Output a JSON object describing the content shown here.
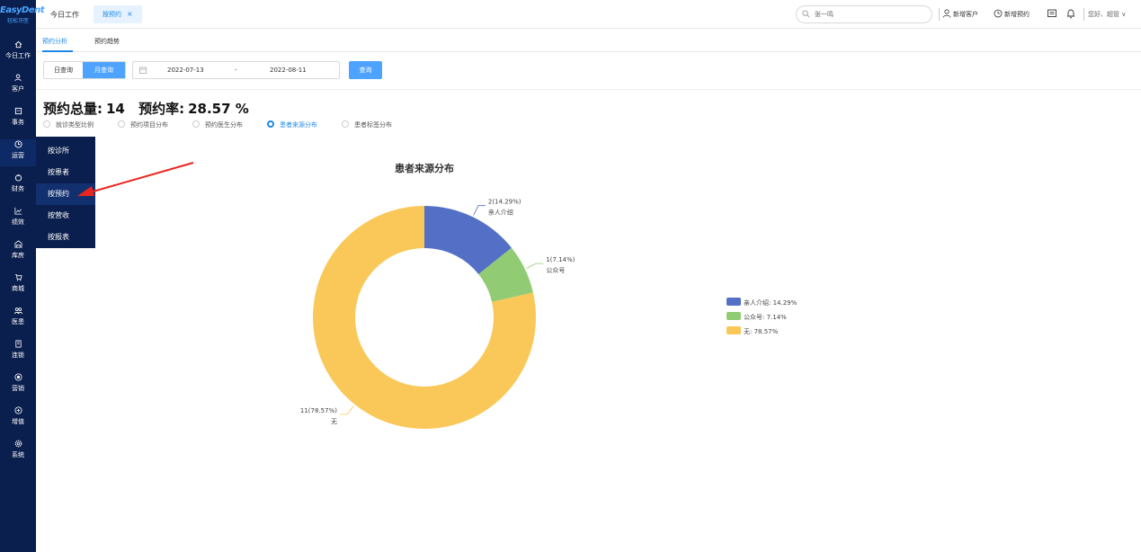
{
  "brand": {
    "name": "EasyDent",
    "subtitle": "轻松牙医"
  },
  "sidebar": {
    "items": [
      {
        "icon": "home-icon",
        "label": "今日工作"
      },
      {
        "icon": "user-icon",
        "label": "客户"
      },
      {
        "icon": "calendar-icon",
        "label": "事务"
      },
      {
        "icon": "clock-icon",
        "label": "运营"
      },
      {
        "icon": "wallet-icon",
        "label": "财务"
      },
      {
        "icon": "line-chart-icon",
        "label": "绩效"
      },
      {
        "icon": "warehouse-icon",
        "label": "库房"
      },
      {
        "icon": "cart-icon",
        "label": "商城"
      },
      {
        "icon": "doctor-icon",
        "label": "医患"
      },
      {
        "icon": "building-icon",
        "label": "连锁"
      },
      {
        "icon": "target-icon",
        "label": "营销"
      },
      {
        "icon": "value-added-icon",
        "label": "增值"
      },
      {
        "icon": "settings-icon",
        "label": "系统"
      }
    ],
    "active_index": 3
  },
  "flyout": {
    "items": [
      "按诊所",
      "按患者",
      "按预约",
      "按营收",
      "按报表"
    ],
    "active_index": 2
  },
  "topbar": {
    "home_tab": "今日工作",
    "active_tab": "按预约",
    "close_glyph": "×",
    "search_value": "张一鸣",
    "new_customer": "新增客户",
    "new_appointment": "新增预约",
    "greeting": "您好、超管 ∨"
  },
  "subtabs": [
    "预约分析",
    "预约趋势"
  ],
  "filters": {
    "day_query": "日查询",
    "month_query": "月查询",
    "start_date": "2022-07-13",
    "separator": "-",
    "end_date": "2022-08-11",
    "query_button": "查询"
  },
  "summary": {
    "total_label": "预约总量:",
    "total_value": "14",
    "rate_label": "预约率:",
    "rate_value": "28.57 %"
  },
  "radios": {
    "options": [
      "就诊类型比例",
      "预约项目分布",
      "预约医生分布",
      "患者来源分布",
      "患者标签分布"
    ],
    "selected_index": 3
  },
  "chart_data": {
    "type": "pie",
    "donut": true,
    "title": "患者来源分布",
    "slices": [
      {
        "name": "亲人介绍",
        "value": 2,
        "percent": 14.29,
        "label": "2(14.29%)",
        "legend": "亲人介绍: 14.29%",
        "color": "#5470c6"
      },
      {
        "name": "公众号",
        "value": 1,
        "percent": 7.14,
        "label": "1(7.14%)",
        "legend": "公众号: 7.14%",
        "color": "#91cc75"
      },
      {
        "name": "无",
        "value": 11,
        "percent": 78.57,
        "label": "11(78.57%)",
        "legend": "无: 78.57%",
        "color": "#fac858"
      }
    ],
    "legend_position": "right"
  },
  "annotation": {
    "arrow_color": "#e8261f"
  }
}
